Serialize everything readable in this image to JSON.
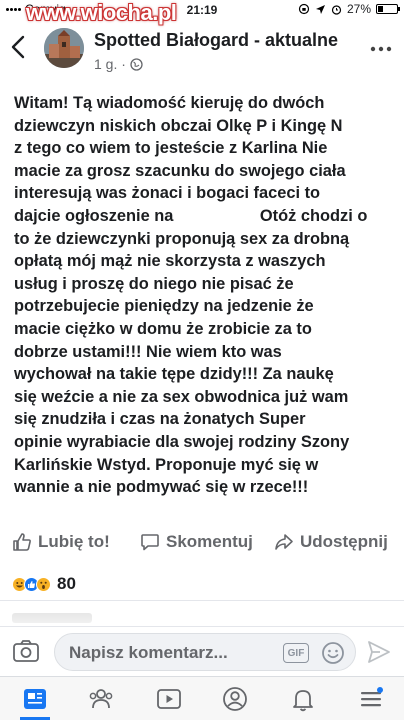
{
  "status_bar": {
    "carrier": "Comviq",
    "watermark": "www.wiocha.pl",
    "time": "21:19",
    "battery_text": "27%",
    "battery_level": 0.27
  },
  "header": {
    "back_icon": "back-chevron-icon",
    "group_name": "Spotted Białogard - aktualne",
    "post_age": "1 g. ·",
    "privacy_icon": "globe-icon",
    "more_icon": "more-dots-icon"
  },
  "post": {
    "lines": [
      "Witam! Tą wiadomość kieruję do dwóch",
      "dziewczyn niskich obczai Olkę P i Kingę N",
      "z tego co wiem to jesteście z Karlina Nie",
      "macie za grosz szacunku do swojego ciała",
      "interesują was żonaci i bogaci faceci to",
      "dajcie ogłoszenie na                   Otóż chodzi o",
      "to że dziewczynki proponują sex za drobną",
      "opłatą mój mąż nie skorzysta z waszych",
      "usług i proszę do niego nie pisać że",
      "potrzebujecie pieniędzy na jedzenie że",
      "macie ciężko w domu że zrobicie za to",
      "dobrze ustami!!! Nie wiem kto was",
      "wychował na takie tępe dzidy!!! Za naukę",
      "się weźcie a nie za sex obwodnica już wam",
      "się znudziła i czas na żonatych Super",
      "opinie wyrabiacie dla swojej rodziny Szony",
      "Karlińskie Wstyd. Proponuje myć się w",
      "wannie a nie podmywać się w rzece!!!"
    ]
  },
  "actions": {
    "like": "Lubię to!",
    "comment": "Skomentuj",
    "share": "Udostępnij"
  },
  "reactions": {
    "icons": [
      "haha-reaction-icon",
      "like-reaction-icon",
      "wow-reaction-icon"
    ],
    "count": "80"
  },
  "composer": {
    "placeholder": "Napisz komentarz...",
    "gif_label": "GIF"
  },
  "tabbar": {
    "tabs": [
      "news-feed-icon",
      "groups-icon",
      "watch-icon",
      "profile-icon",
      "notifications-icon",
      "menu-icon"
    ]
  },
  "colors": {
    "accent": "#1877f2",
    "text": "#1c1e21",
    "muted": "#65676b"
  }
}
